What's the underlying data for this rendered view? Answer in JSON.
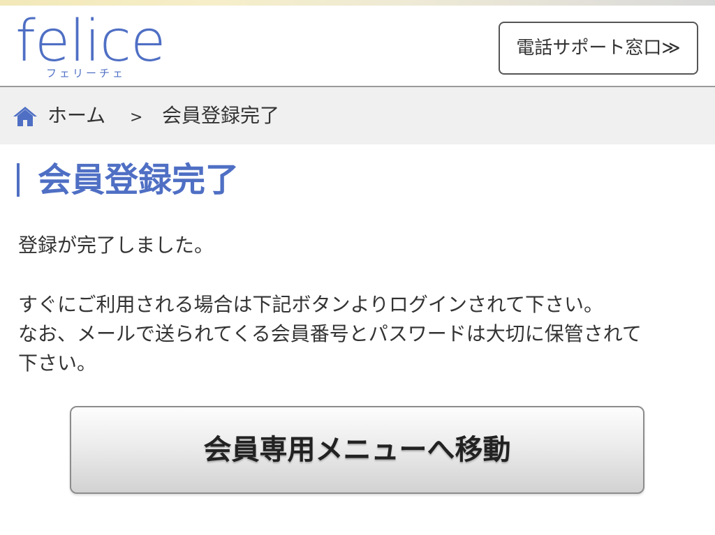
{
  "header": {
    "logo_word": "felice",
    "logo_kana": "フェリーチェ",
    "phone_support_label": "電話サポート窓口≫"
  },
  "breadcrumb": {
    "home_label": "ホーム",
    "separator": ">",
    "current_label": "会員登録完了"
  },
  "main": {
    "title": "会員登録完了",
    "lines": [
      "登録が完了しました。",
      "すぐにご利用される場合は下記ボタンよりログインされて下さい。",
      "なお、メールで送られてくる会員番号とパスワードは大切に保管されて",
      "下さい。"
    ],
    "member_menu_button": "会員専用メニューへ移動"
  },
  "colors": {
    "accent": "#4f6fc4",
    "text": "#333333",
    "breadcrumb_bg": "#f0f0f0"
  },
  "icons": {
    "home": "home-icon"
  }
}
